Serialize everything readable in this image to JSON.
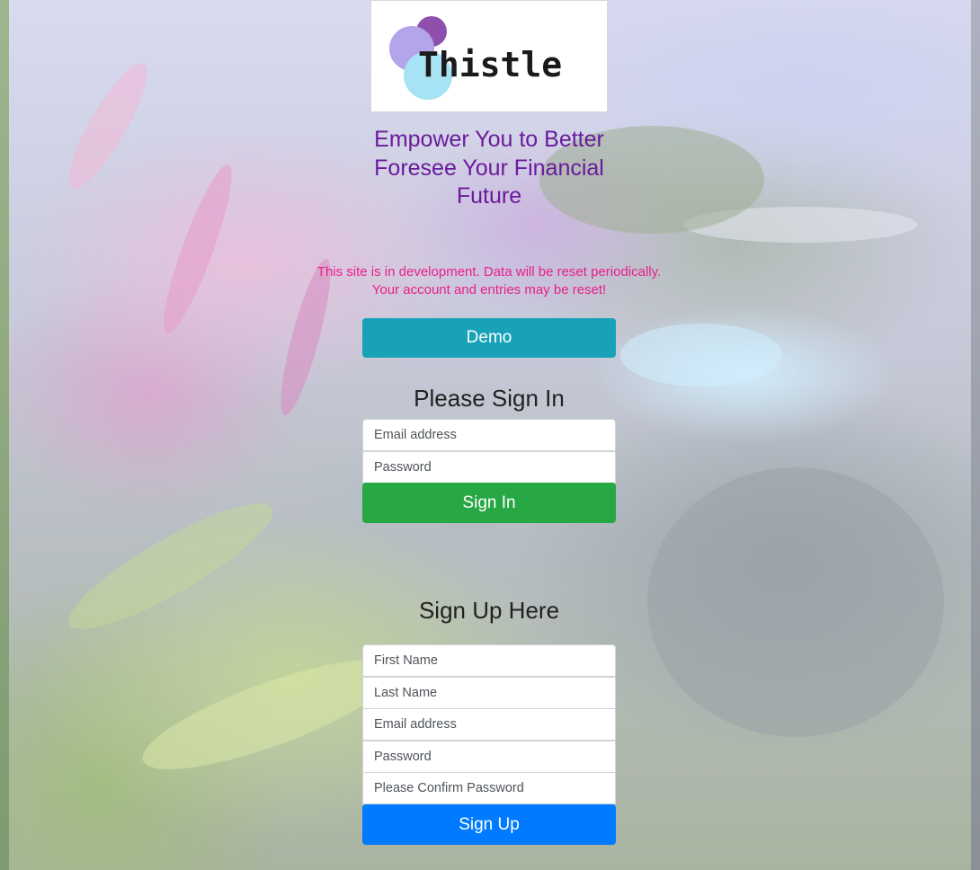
{
  "logo": {
    "text": "Thistle",
    "colors": {
      "purple_dark": "#8e4fad",
      "purple_light": "#b4a4ea",
      "cyan": "#a6e3f5"
    }
  },
  "tagline": "Empower You to Better Foresee Your Financial Future",
  "dev_notice": {
    "line1": "This site is in development. Data will be reset periodically.",
    "line2": "Your account and entries may be reset!"
  },
  "demo_button": {
    "label": "Demo",
    "color": "#17a2b8"
  },
  "sign_in": {
    "heading": "Please Sign In",
    "email_placeholder": "Email address",
    "password_placeholder": "Password",
    "submit_label": "Sign In",
    "submit_color": "#28a745"
  },
  "sign_up": {
    "heading": "Sign Up Here",
    "first_name_placeholder": "First Name",
    "last_name_placeholder": "Last Name",
    "email_placeholder": "Email address",
    "password_placeholder": "Password",
    "confirm_password_placeholder": "Please Confirm Password",
    "submit_label": "Sign Up",
    "submit_color": "#007bff"
  },
  "colors": {
    "tagline": "#6a1b9a",
    "notice": "#e8208a"
  }
}
